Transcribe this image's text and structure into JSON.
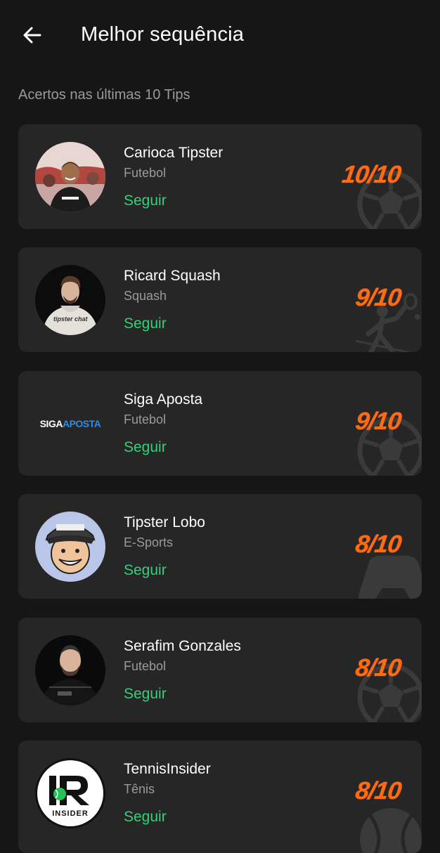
{
  "header": {
    "title": "Melhor sequência"
  },
  "subtitle": "Acertos nas últimas 10 Tips",
  "tipsters": [
    {
      "name": "Carioca Tipster",
      "sport": "Futebol",
      "follow_label": "Seguir",
      "score": "10/10",
      "sport_icon": "soccer-ball-icon",
      "avatar_icon": "profile-photo"
    },
    {
      "name": "Ricard Squash",
      "sport": "Squash",
      "follow_label": "Seguir",
      "score": "9/10",
      "sport_icon": "squash-player-icon",
      "avatar_icon": "profile-photo",
      "avatar_text": "tipster chat"
    },
    {
      "name": "Siga Aposta",
      "sport": "Futebol",
      "follow_label": "Seguir",
      "score": "9/10",
      "sport_icon": "soccer-ball-icon",
      "avatar_icon": "siga-aposta-logo",
      "avatar_text_a": "SIGA",
      "avatar_text_b": "APOSTA"
    },
    {
      "name": "Tipster Lobo",
      "sport": "E-Sports",
      "follow_label": "Seguir",
      "score": "8/10",
      "sport_icon": "gamepad-icon",
      "avatar_icon": "cartoon-avatar"
    },
    {
      "name": "Serafim Gonzales",
      "sport": "Futebol",
      "follow_label": "Seguir",
      "score": "8/10",
      "sport_icon": "soccer-ball-icon",
      "avatar_icon": "profile-photo"
    },
    {
      "name": "TennisInsider",
      "sport": "Tênis",
      "follow_label": "Seguir",
      "score": "8/10",
      "sport_icon": "tennis-ball-icon",
      "avatar_icon": "tennis-insider-logo",
      "avatar_text": "INSIDER"
    }
  ],
  "colors": {
    "background": "#161616",
    "card": "#262626",
    "accent_follow": "#33d17a",
    "score": "#ff6a13",
    "muted_text": "#9a9a9a"
  }
}
